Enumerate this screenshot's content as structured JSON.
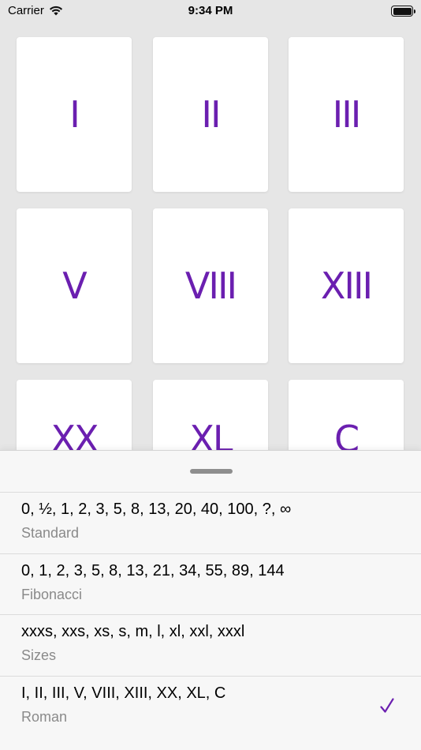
{
  "status_bar": {
    "carrier": "Carrier",
    "time": "9:34 PM"
  },
  "cards": [
    {
      "label": "I"
    },
    {
      "label": "II"
    },
    {
      "label": "III"
    },
    {
      "label": "V"
    },
    {
      "label": "VIII"
    },
    {
      "label": "XIII"
    },
    {
      "label": "XX"
    },
    {
      "label": "XL"
    },
    {
      "label": "C"
    }
  ],
  "sheet": {
    "options": [
      {
        "values": "0, ½, 1, 2, 3, 5, 8, 13, 20, 40, 100, ?, ∞",
        "name": "Standard",
        "selected": false
      },
      {
        "values": "0, 1, 2, 3, 5, 8, 13, 21, 34, 55, 89, 144",
        "name": "Fibonacci",
        "selected": false
      },
      {
        "values": "xxxs, xxs, xs, s, m, l, xl, xxl, xxxl",
        "name": "Sizes",
        "selected": false
      },
      {
        "values": "I, II, III, V, VIII, XIII, XX, XL, C",
        "name": "Roman",
        "selected": true
      }
    ]
  },
  "colors": {
    "accent": "#6b1fb0",
    "background": "#e6e6e6",
    "sheet": "#f7f7f7"
  }
}
